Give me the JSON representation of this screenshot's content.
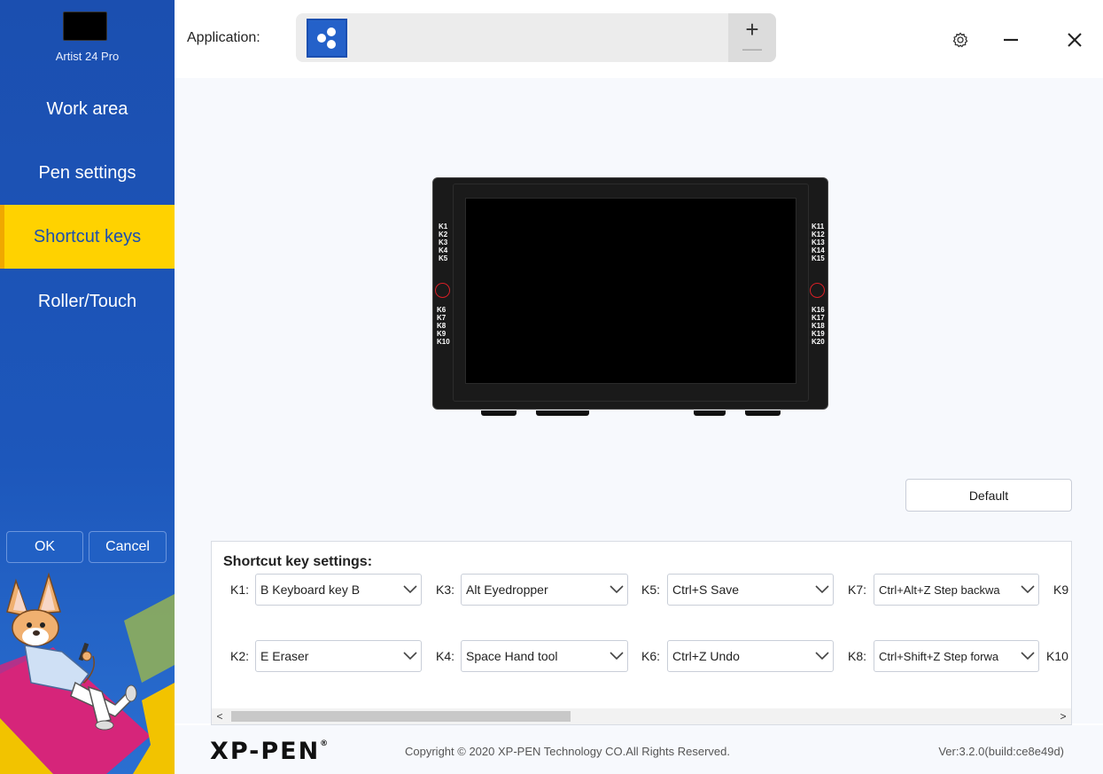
{
  "sidebar": {
    "device_name": "Artist 24 Pro",
    "items": [
      {
        "label": "Work area"
      },
      {
        "label": "Pen settings"
      },
      {
        "label": "Shortcut keys",
        "active": true
      },
      {
        "label": "Roller/Touch"
      }
    ],
    "ok_label": "OK",
    "cancel_label": "Cancel"
  },
  "header": {
    "application_label": "Application:",
    "add_symbol": "+",
    "remove_symbol": "—"
  },
  "icons": {
    "app": "app-icon",
    "settings": "gear-icon",
    "minimize": "minimize-icon",
    "close": "close-icon"
  },
  "tablet": {
    "left_keys_top": [
      "K1",
      "K2",
      "K3",
      "K4",
      "K5"
    ],
    "left_keys_bottom": [
      "K6",
      "K7",
      "K8",
      "K9",
      "K10"
    ],
    "right_keys_top": [
      "K11",
      "K12",
      "K13",
      "K14",
      "K15"
    ],
    "right_keys_bottom": [
      "K16",
      "K17",
      "K18",
      "K19",
      "K20"
    ]
  },
  "default_label": "Default",
  "shortcut_settings": {
    "title": "Shortcut key settings:",
    "keys": [
      {
        "key": "K1:",
        "value": "B Keyboard key B"
      },
      {
        "key": "K2:",
        "value": "E Eraser"
      },
      {
        "key": "K3:",
        "value": "Alt Eyedropper"
      },
      {
        "key": "K4:",
        "value": "Space Hand tool"
      },
      {
        "key": "K5:",
        "value": "Ctrl+S Save"
      },
      {
        "key": "K6:",
        "value": "Ctrl+Z Undo"
      },
      {
        "key": "K7:",
        "value": "Ctrl+Alt+Z Step backwa"
      },
      {
        "key": "K8:",
        "value": "Ctrl+Shift+Z Step forwa"
      },
      {
        "key": "K9",
        "value": ""
      },
      {
        "key": "K10",
        "value": ""
      }
    ],
    "scroll_left": "<",
    "scroll_right": ">"
  },
  "footer": {
    "logo_text": "XP-PEN",
    "logo_mark": "®",
    "copyright": "Copyright © 2020 XP-PEN Technology CO.All Rights Reserved.",
    "version": "Ver:3.2.0(build:ce8e49d)"
  },
  "colors": {
    "sidebar_blue": "#1b4fb0",
    "active_yellow": "#ffd200",
    "dial_red": "#d81f26"
  }
}
